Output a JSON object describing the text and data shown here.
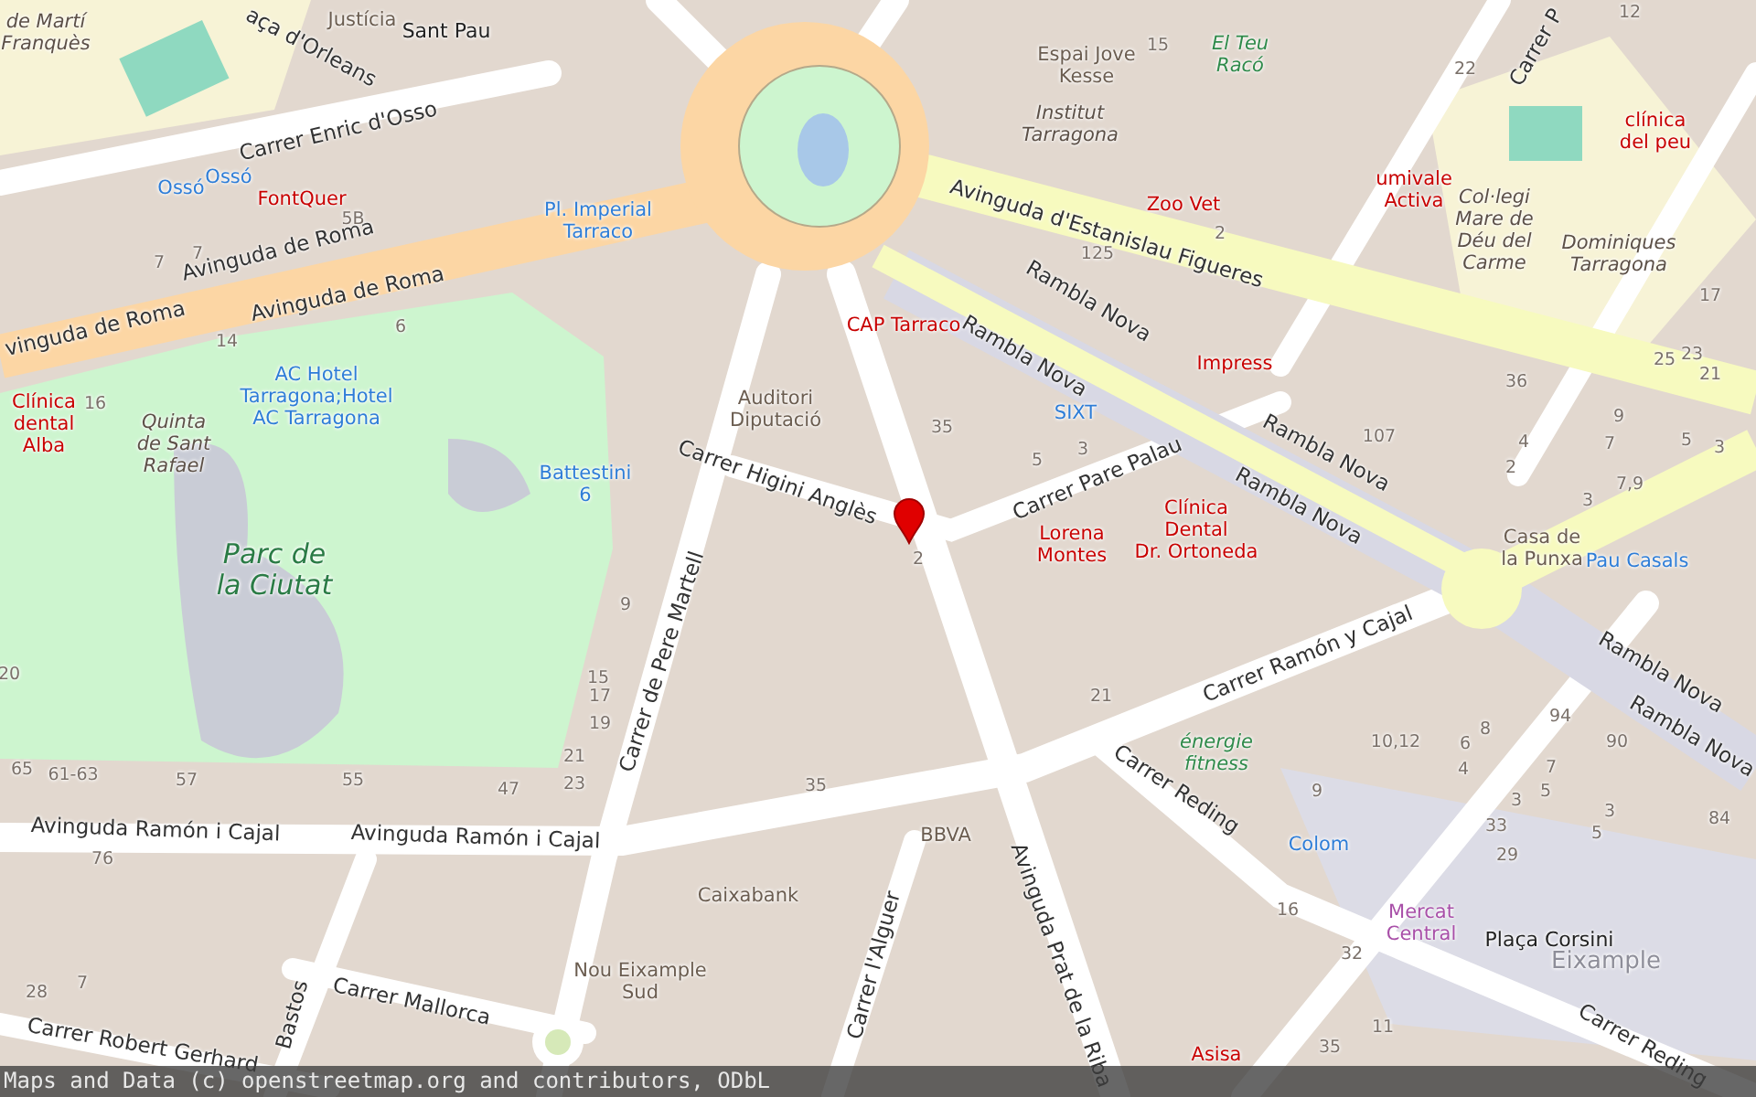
{
  "map": {
    "labels": [
      {
        "kind": "street",
        "text": "aça d'Orleans"
      },
      {
        "kind": "street",
        "text": "Carrer Enric d'Osso"
      },
      {
        "kind": "street",
        "text": "Avinguda de Roma"
      },
      {
        "kind": "street",
        "text": "Avinguda de Roma"
      },
      {
        "kind": "street",
        "text": "vinguda de Roma"
      },
      {
        "kind": "street",
        "text": "Avinguda d'Estanislau Figueres"
      },
      {
        "kind": "street",
        "text": "Rambla Nova"
      },
      {
        "kind": "street",
        "text": "Rambla Nova"
      },
      {
        "kind": "street",
        "text": "Rambla Nova"
      },
      {
        "kind": "street",
        "text": "Rambla Nova"
      },
      {
        "kind": "street",
        "text": "Carrer Pare Palau"
      },
      {
        "kind": "street",
        "text": "Carrer Higini Anglès"
      },
      {
        "kind": "street",
        "text": "Carrer de Pere Martell"
      },
      {
        "kind": "street",
        "text": "Avinguda Ramón i Cajal"
      },
      {
        "kind": "street",
        "text": "Avinguda Ramón i Cajal"
      },
      {
        "kind": "street",
        "text": "Carrer Ramón y Cajal"
      },
      {
        "kind": "street",
        "text": "Carrer Reding"
      },
      {
        "kind": "street",
        "text": "Avinguda Prat de la Riba"
      },
      {
        "kind": "street",
        "text": "Carrer l'Alguer"
      },
      {
        "kind": "street",
        "text": "Carrer Mallorca"
      },
      {
        "kind": "street",
        "text": "Carrer Robert Gerhard"
      },
      {
        "kind": "street",
        "text": "Bastos"
      },
      {
        "kind": "street",
        "text": "Carrer Reding"
      },
      {
        "kind": "street",
        "text": "Rambla Nova"
      },
      {
        "kind": "street",
        "text": "Rambla Nova"
      },
      {
        "kind": "street",
        "text": "Carrer P"
      },
      {
        "kind": "health",
        "text": "FontQuer"
      },
      {
        "kind": "health",
        "text": "CAP Tarraco"
      },
      {
        "kind": "health",
        "text": "Zoo Vet"
      },
      {
        "kind": "health",
        "text": "umivale\nActiva"
      },
      {
        "kind": "health",
        "text": "Impress"
      },
      {
        "kind": "health",
        "text": "Clínica\ndental\nAlba"
      },
      {
        "kind": "health",
        "text": "Lorena\nMontes"
      },
      {
        "kind": "health",
        "text": "Clínica\nDental\nDr. Ortoneda"
      },
      {
        "kind": "health",
        "text": "Asisa"
      },
      {
        "kind": "health",
        "text": "clínica\ndel peu"
      },
      {
        "kind": "transport",
        "text": "Ossó"
      },
      {
        "kind": "transport",
        "text": "Ossó"
      },
      {
        "kind": "transport",
        "text": "Pl. Imperial\nTarraco"
      },
      {
        "kind": "transport",
        "text": "AC Hotel\nTarragona;Hotel\nAC Tarragona"
      },
      {
        "kind": "transport",
        "text": "Battestini\n6"
      },
      {
        "kind": "transport",
        "text": "SIXT"
      },
      {
        "kind": "transport",
        "text": "Pau Casals"
      },
      {
        "kind": "transport",
        "text": "Colom"
      },
      {
        "kind": "amenity",
        "text": "Justícia"
      },
      {
        "kind": "landmark",
        "text": "Sant Pau"
      },
      {
        "kind": "amenity",
        "text": "Auditori\nDiputació"
      },
      {
        "kind": "amenity",
        "text": "Espai Jove\nKesse"
      },
      {
        "kind": "amenity",
        "text": "Caixabank"
      },
      {
        "kind": "amenity",
        "text": "BBVA"
      },
      {
        "kind": "amenity",
        "text": "Nou Eixample\nSud"
      },
      {
        "kind": "amenity",
        "text": "Casa de\nla Punxa"
      },
      {
        "kind": "market",
        "text": "Mercat\nCentral"
      },
      {
        "kind": "landmark",
        "text": "Plaça Corsini"
      },
      {
        "kind": "district",
        "text": "Eixample"
      },
      {
        "kind": "school",
        "text": "Institut\nTarragona"
      },
      {
        "kind": "school",
        "text": "Col·legi\nMare de\nDéu del\nCarme"
      },
      {
        "kind": "school",
        "text": "Dominiques\nTarragona"
      },
      {
        "kind": "school",
        "text": "Quinta\nde Sant\nRafael"
      },
      {
        "kind": "school",
        "text": "de Martí\nFranquès"
      },
      {
        "kind": "leisure",
        "text": "El Teu\nRacó"
      },
      {
        "kind": "park",
        "text": "Parc de\nla Ciutat"
      },
      {
        "kind": "leisure",
        "text": "énergie\nfitness"
      },
      {
        "kind": "number",
        "text": "5B"
      },
      {
        "kind": "number",
        "text": "7"
      },
      {
        "kind": "number",
        "text": "7"
      },
      {
        "kind": "number",
        "text": "14"
      },
      {
        "kind": "number",
        "text": "6"
      },
      {
        "kind": "number",
        "text": "16"
      },
      {
        "kind": "number",
        "text": "15"
      },
      {
        "kind": "number",
        "text": "125"
      },
      {
        "kind": "number",
        "text": "2"
      },
      {
        "kind": "number",
        "text": "22"
      },
      {
        "kind": "number",
        "text": "12"
      },
      {
        "kind": "number",
        "text": "35"
      },
      {
        "kind": "number",
        "text": "5"
      },
      {
        "kind": "number",
        "text": "3"
      },
      {
        "kind": "number",
        "text": "107"
      },
      {
        "kind": "number",
        "text": "36"
      },
      {
        "kind": "number",
        "text": "9"
      },
      {
        "kind": "number",
        "text": "4"
      },
      {
        "kind": "number",
        "text": "7"
      },
      {
        "kind": "number",
        "text": "5"
      },
      {
        "kind": "number",
        "text": "3"
      },
      {
        "kind": "number",
        "text": "2"
      },
      {
        "kind": "number",
        "text": "7,9"
      },
      {
        "kind": "number",
        "text": "3"
      },
      {
        "kind": "number",
        "text": "17"
      },
      {
        "kind": "number",
        "text": "25"
      },
      {
        "kind": "number",
        "text": "23"
      },
      {
        "kind": "number",
        "text": "21"
      },
      {
        "kind": "number",
        "text": "20"
      },
      {
        "kind": "number",
        "text": "65"
      },
      {
        "kind": "number",
        "text": "61-63"
      },
      {
        "kind": "number",
        "text": "57"
      },
      {
        "kind": "number",
        "text": "55"
      },
      {
        "kind": "number",
        "text": "47"
      },
      {
        "kind": "number",
        "text": "76"
      },
      {
        "kind": "number",
        "text": "28"
      },
      {
        "kind": "number",
        "text": "7"
      },
      {
        "kind": "number",
        "text": "15"
      },
      {
        "kind": "number",
        "text": "17"
      },
      {
        "kind": "number",
        "text": "19"
      },
      {
        "kind": "number",
        "text": "21"
      },
      {
        "kind": "number",
        "text": "23"
      },
      {
        "kind": "number",
        "text": "35"
      },
      {
        "kind": "number",
        "text": "9"
      },
      {
        "kind": "number",
        "text": "21"
      },
      {
        "kind": "number",
        "text": "10,12"
      },
      {
        "kind": "number",
        "text": "8"
      },
      {
        "kind": "number",
        "text": "6"
      },
      {
        "kind": "number",
        "text": "4"
      },
      {
        "kind": "number",
        "text": "94"
      },
      {
        "kind": "number",
        "text": "90"
      },
      {
        "kind": "number",
        "text": "7"
      },
      {
        "kind": "number",
        "text": "5"
      },
      {
        "kind": "number",
        "text": "3"
      },
      {
        "kind": "number",
        "text": "33"
      },
      {
        "kind": "number",
        "text": "29"
      },
      {
        "kind": "number",
        "text": "3"
      },
      {
        "kind": "number",
        "text": "5"
      },
      {
        "kind": "number",
        "text": "84"
      },
      {
        "kind": "number",
        "text": "9"
      },
      {
        "kind": "number",
        "text": "16"
      },
      {
        "kind": "number",
        "text": "32"
      },
      {
        "kind": "number",
        "text": "11"
      },
      {
        "kind": "number",
        "text": "35"
      },
      {
        "kind": "number",
        "text": "2"
      }
    ]
  },
  "attribution": "Maps and Data (c) openstreetmap.org and contributors, ODbL"
}
